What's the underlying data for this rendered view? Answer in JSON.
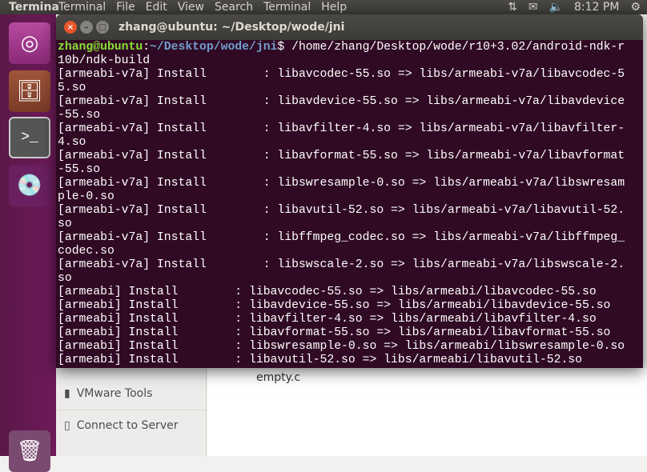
{
  "panel": {
    "app_name": "Terminal",
    "menus": [
      "Terminal",
      "File",
      "Edit",
      "View",
      "Search",
      "Terminal",
      "Help"
    ],
    "time": "8:12 PM",
    "indicators": [
      "network-icon",
      "mail-icon",
      "volume-icon",
      "power-icon"
    ]
  },
  "launcher": {
    "items": [
      "ubuntu-dash-icon",
      "files-icon",
      "terminal-icon",
      "dvd-icon",
      "trash-icon"
    ]
  },
  "terminal": {
    "title": "zhang@ubuntu: ~/Desktop/wode/jni",
    "prompt_user": "zhang@ubuntu",
    "prompt_sep": ":",
    "prompt_path": "~/Desktop/wode/jni",
    "prompt_cmd": "$ /home/zhang/Desktop/wode/r10+3.02/android-ndk-r",
    "lines": [
      "10b/ndk-build",
      "[armeabi-v7a] Install        : libavcodec-55.so => libs/armeabi-v7a/libavcodec-5",
      "5.so",
      "[armeabi-v7a] Install        : libavdevice-55.so => libs/armeabi-v7a/libavdevice",
      "-55.so",
      "[armeabi-v7a] Install        : libavfilter-4.so => libs/armeabi-v7a/libavfilter-",
      "4.so",
      "[armeabi-v7a] Install        : libavformat-55.so => libs/armeabi-v7a/libavformat",
      "-55.so",
      "[armeabi-v7a] Install        : libswresample-0.so => libs/armeabi-v7a/libswresam",
      "ple-0.so",
      "[armeabi-v7a] Install        : libavutil-52.so => libs/armeabi-v7a/libavutil-52.",
      "so",
      "[armeabi-v7a] Install        : libffmpeg_codec.so => libs/armeabi-v7a/libffmpeg_",
      "codec.so",
      "[armeabi-v7a] Install        : libswscale-2.so => libs/armeabi-v7a/libswscale-2.",
      "so",
      "[armeabi] Install        : libavcodec-55.so => libs/armeabi/libavcodec-55.so",
      "[armeabi] Install        : libavdevice-55.so => libs/armeabi/libavdevice-55.so",
      "[armeabi] Install        : libavfilter-4.so => libs/armeabi/libavfilter-4.so",
      "[armeabi] Install        : libavformat-55.so => libs/armeabi/libavformat-55.so",
      "[armeabi] Install        : libswresample-0.so => libs/armeabi/libswresample-0.so",
      "[armeabi] Install        : libavutil-52.so => libs/armeabi/libavutil-52.so"
    ]
  },
  "files": {
    "sidebar": [
      "VMware Tools",
      "Connect to Server"
    ],
    "file_name": "empty.c"
  }
}
